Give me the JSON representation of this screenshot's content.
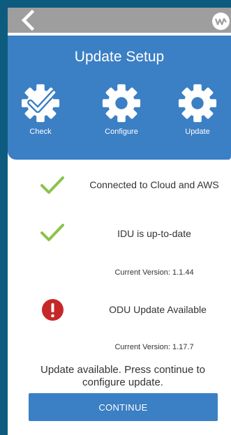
{
  "header": {
    "title": "Update Setup",
    "steps": [
      {
        "label": "Check",
        "icon": "gear-check-icon"
      },
      {
        "label": "Configure",
        "icon": "gear-icon"
      },
      {
        "label": "Update",
        "icon": "gear-icon"
      }
    ]
  },
  "status": [
    {
      "icon": "check-icon",
      "text": "Connected to Cloud and AWS"
    },
    {
      "icon": "check-icon",
      "text": "IDU is up-to-date",
      "version": "Current Version: 1.1.44"
    },
    {
      "icon": "alert-icon",
      "text": "ODU Update Available",
      "version": "Current Version: 1.17.7"
    }
  ],
  "message": "Update available. Press continue to configure update.",
  "continue_label": "CONTINUE",
  "colors": {
    "accent": "#3b7fc4",
    "check": "#8bc34a",
    "alert": "#c62828",
    "topbar": "#9e9e9e",
    "frame": "#0e5b80"
  }
}
